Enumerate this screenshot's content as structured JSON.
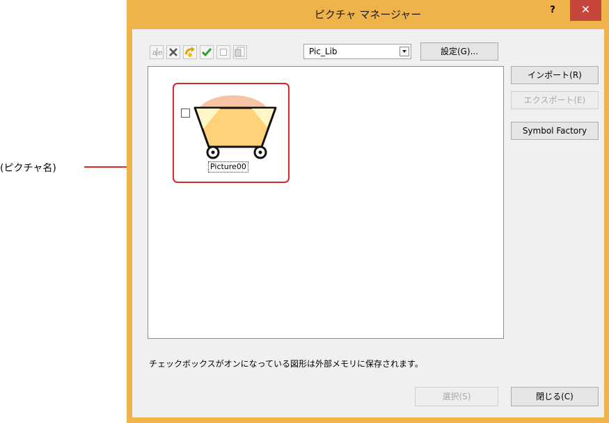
{
  "annotation": {
    "label": "(ピクチャ名)"
  },
  "window": {
    "title": "ピクチャ マネージャー",
    "help_label": "?",
    "close_label": "✕"
  },
  "toolbar": {
    "icons": [
      "rename-icon",
      "delete-icon",
      "restore-icon",
      "check-icon",
      "checkbox-icon",
      "properties-icon"
    ],
    "library_select": {
      "value": "Pic_Lib"
    },
    "settings_label": "設定(G)..."
  },
  "side_buttons": {
    "import_label": "インポート(R)",
    "export_label": "エクスポート(E)",
    "symbol_factory_label": "Symbol Factory"
  },
  "pictures": [
    {
      "name": "Picture00",
      "checked": false,
      "icon": "cart-icon"
    }
  ],
  "note": "チェックボックスがオンになっている図形は外部メモリに保存されます。",
  "footer": {
    "select_label": "選択(S)",
    "close_label": "閉じる(C)"
  },
  "colors": {
    "accent_frame": "#d8262b",
    "window_border": "#f0b24a",
    "close_button": "#c7463b"
  }
}
